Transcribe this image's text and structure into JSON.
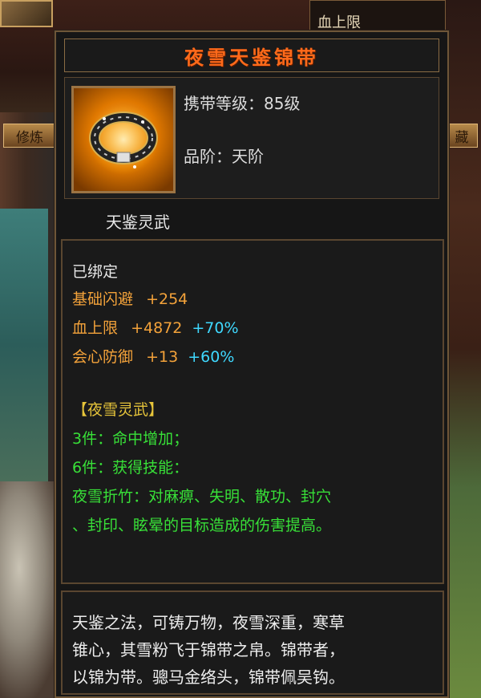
{
  "background": {
    "hp_label": "血上限",
    "left_button": "修炼",
    "right_button": "藏"
  },
  "tooltip": {
    "title": "夜雪天鉴锦带",
    "carry_level": "携带等级：85级",
    "grade": "品阶：天阶",
    "set_group": "天鉴灵武",
    "bound": "已绑定",
    "attributes": [
      {
        "name": "基础闪避",
        "value": "+254",
        "bonus": ""
      },
      {
        "name": "血上限",
        "value": "+4872",
        "bonus": "+70%"
      },
      {
        "name": "会心防御",
        "value": "+13",
        "bonus": "+60%"
      }
    ],
    "set_name": "【夜雪灵武】",
    "set_bonus_3": "3件：命中增加；",
    "set_bonus_6": "6件：获得技能：",
    "skill_line1": "夜雪折竹：对麻痹、失明、散功、封穴",
    "skill_line2": "、封印、眩晕的目标造成的伤害提高。",
    "description": [
      "天鉴之法，可铸万物，夜雪深重，寒草",
      "锥心，其雪粉飞于锦带之帛。锦带者，",
      "以锦为带。骢马金络头，锦带佩吴钩。"
    ]
  },
  "colors": {
    "title": "#ff6a1a",
    "attribute_orange": "#f3a23a",
    "bonus_cyan": "#3fd9ff",
    "set_green": "#38e038",
    "set_name_gold": "#e6c43a"
  },
  "icons": {
    "item": "belt-icon"
  }
}
